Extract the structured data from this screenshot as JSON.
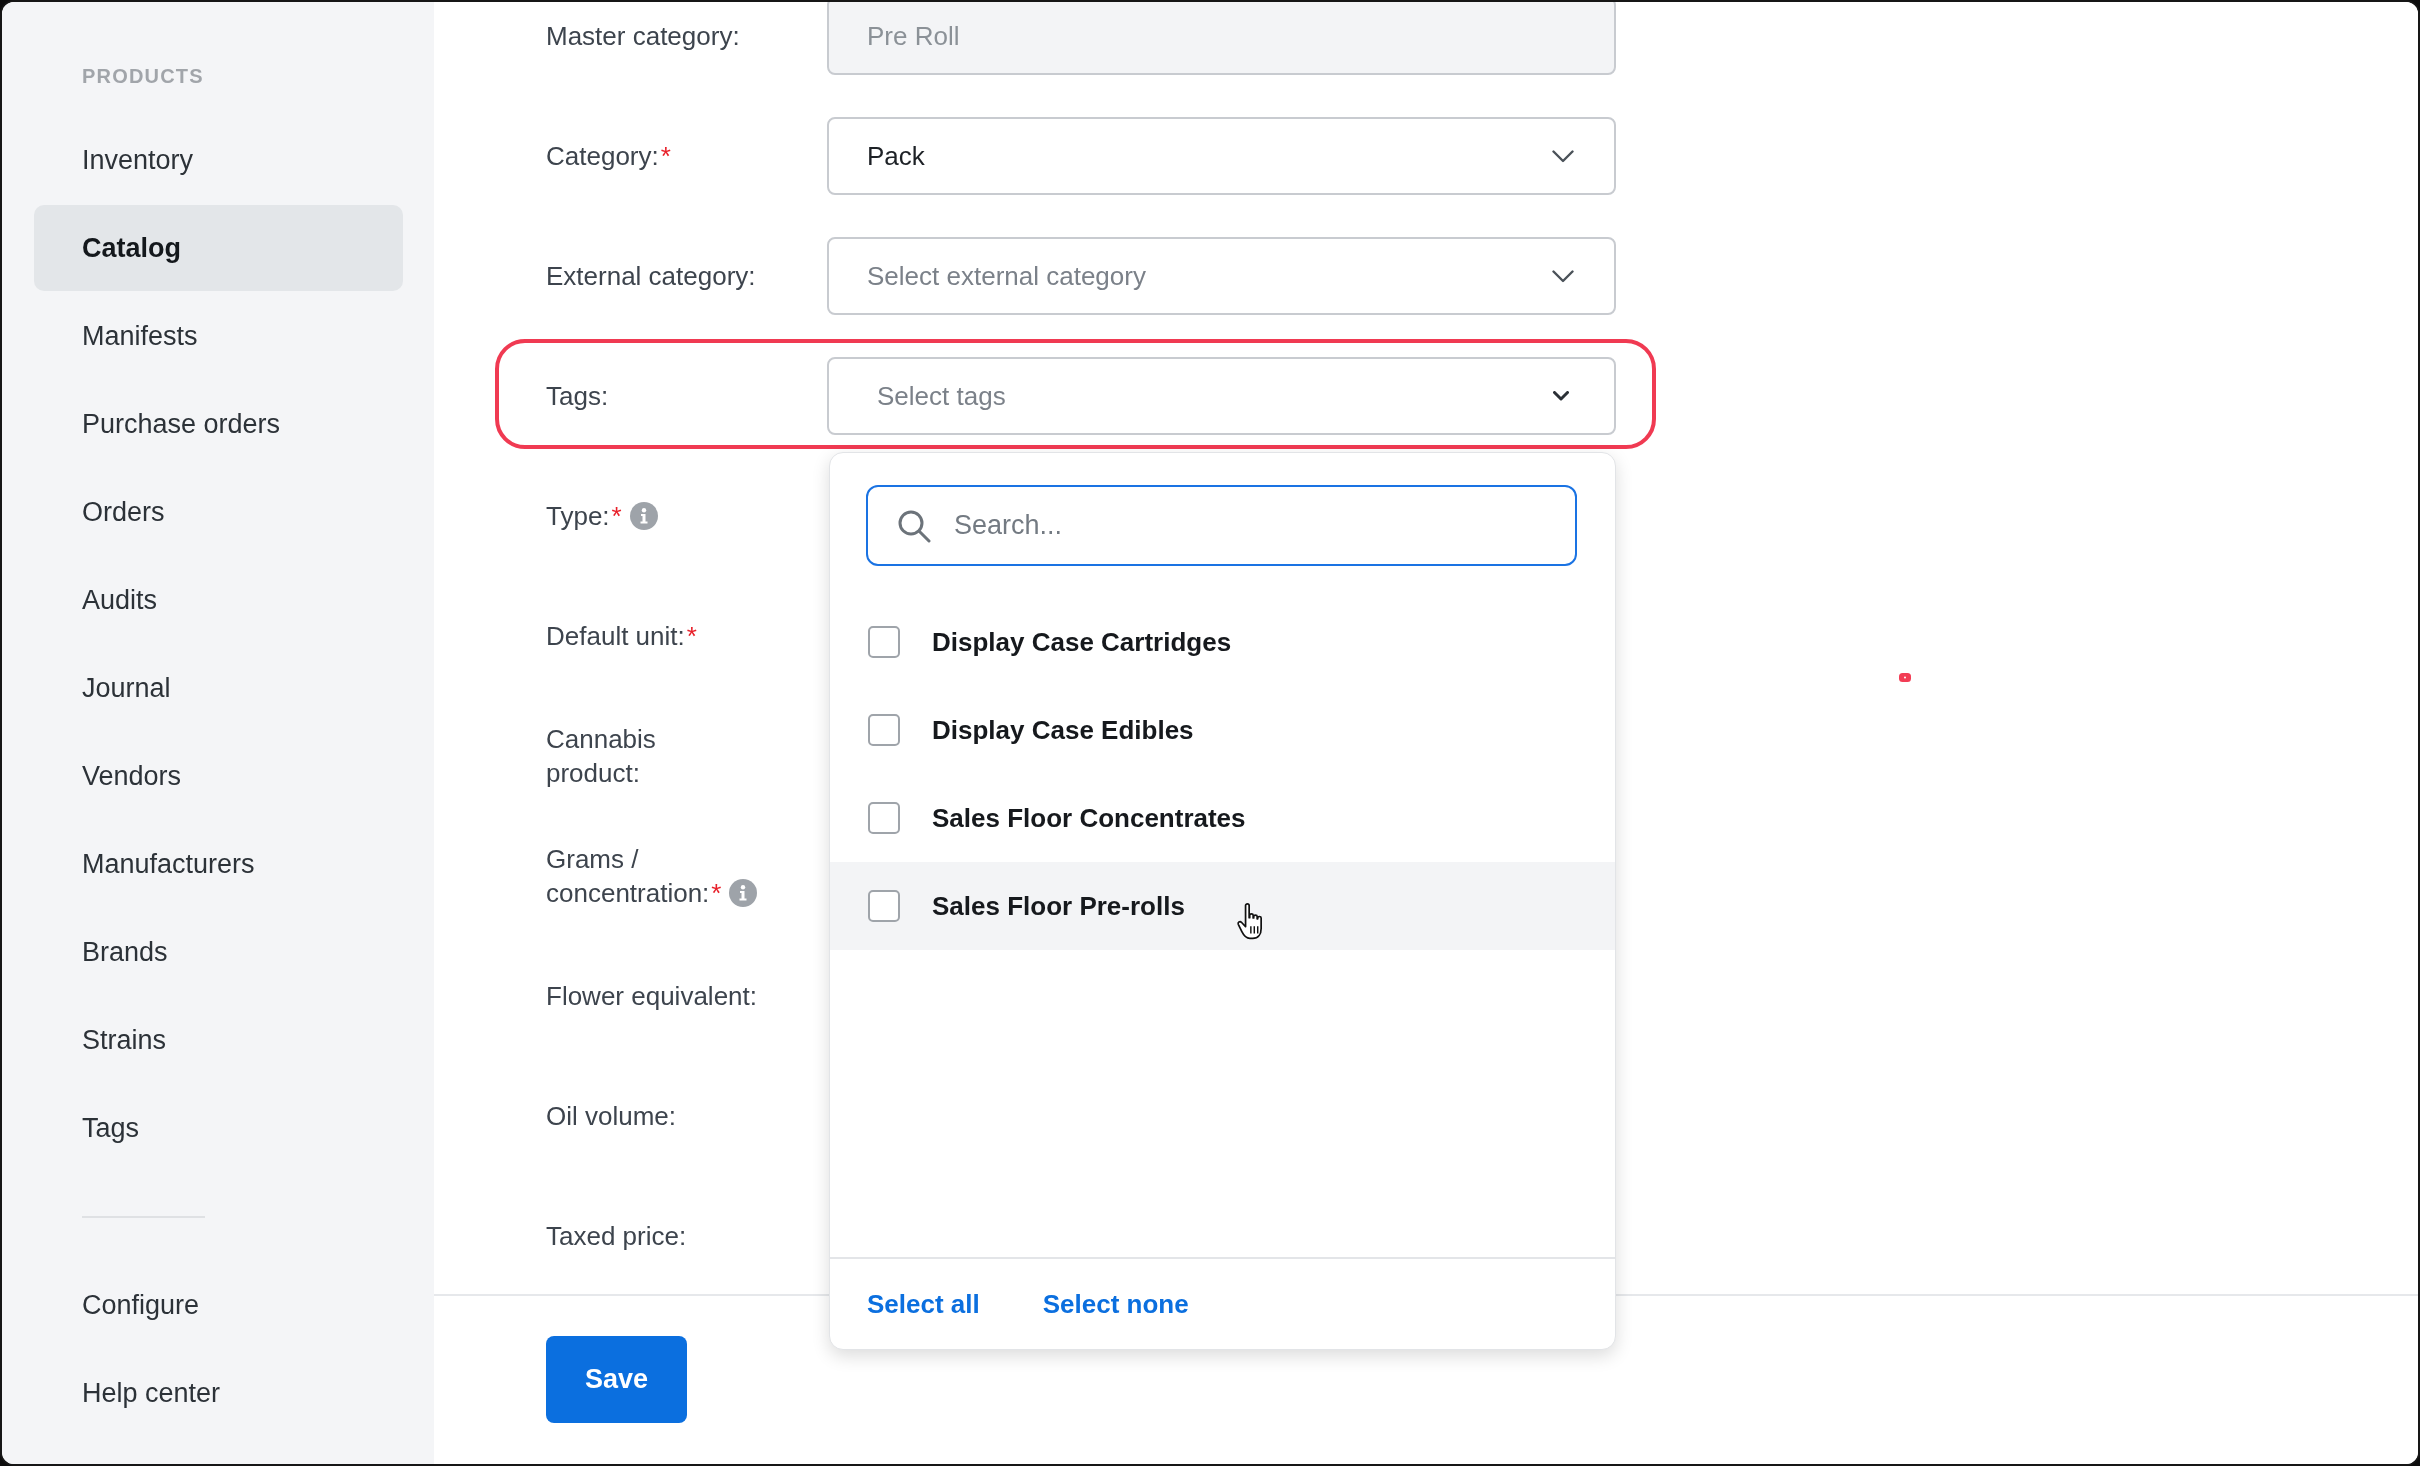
{
  "sidebar": {
    "section_title": "PRODUCTS",
    "items": [
      {
        "label": "Inventory",
        "selected": false
      },
      {
        "label": "Catalog",
        "selected": true
      },
      {
        "label": "Manifests",
        "selected": false
      },
      {
        "label": "Purchase orders",
        "selected": false
      },
      {
        "label": "Orders",
        "selected": false
      },
      {
        "label": "Audits",
        "selected": false
      },
      {
        "label": "Journal",
        "selected": false
      },
      {
        "label": "Vendors",
        "selected": false
      },
      {
        "label": "Manufacturers",
        "selected": false
      },
      {
        "label": "Brands",
        "selected": false
      },
      {
        "label": "Strains",
        "selected": false
      },
      {
        "label": "Tags",
        "selected": false
      }
    ],
    "footer_items": [
      {
        "label": "Configure",
        "selected": false
      },
      {
        "label": "Help center",
        "selected": false
      }
    ]
  },
  "form": {
    "fields": [
      {
        "label": "Master category:",
        "info": false,
        "control": {
          "kind": "text",
          "value": "Pre Roll",
          "disabled": true
        }
      },
      {
        "label": "Category:",
        "required_mark": "*",
        "info": false,
        "control": {
          "kind": "select",
          "value": "Pack",
          "disabled": false
        }
      },
      {
        "label": "External category:",
        "info": false,
        "control": {
          "kind": "select",
          "placeholder": "Select external category",
          "disabled": false
        }
      },
      {
        "label": "Tags:",
        "info": false,
        "control": {
          "kind": "multiselect",
          "placeholder": "Select tags",
          "disabled": false,
          "highlighted": true,
          "open": true,
          "dropdown": {
            "search": {
              "placeholder": "Search...",
              "focused": true
            },
            "options": [
              {
                "label": "Display Case Cartridges",
                "checked": false,
                "hovered": false
              },
              {
                "label": "Display Case Edibles",
                "checked": false,
                "hovered": false
              },
              {
                "label": "Sales Floor Concentrates",
                "checked": false,
                "hovered": false
              },
              {
                "label": "Sales Floor Pre-rolls",
                "checked": false,
                "hovered": true
              }
            ],
            "actions": [
              "Select all",
              "Select none"
            ]
          }
        }
      },
      {
        "label": "Type:",
        "required_mark": "*",
        "info": true
      },
      {
        "label": "Default unit:",
        "required_mark": "*",
        "info": false
      },
      {
        "label": "Cannabis\nproduct:",
        "info": false
      },
      {
        "label": "Grams /\nconcentration:",
        "required_mark": "*",
        "info": true
      },
      {
        "label": "Flower equivalent:",
        "info": false
      },
      {
        "label": "Oil volume:",
        "info": false
      },
      {
        "label": "Taxed price:",
        "info": false
      }
    ]
  },
  "footer": {
    "buttons": [
      {
        "label": "Save"
      }
    ]
  }
}
